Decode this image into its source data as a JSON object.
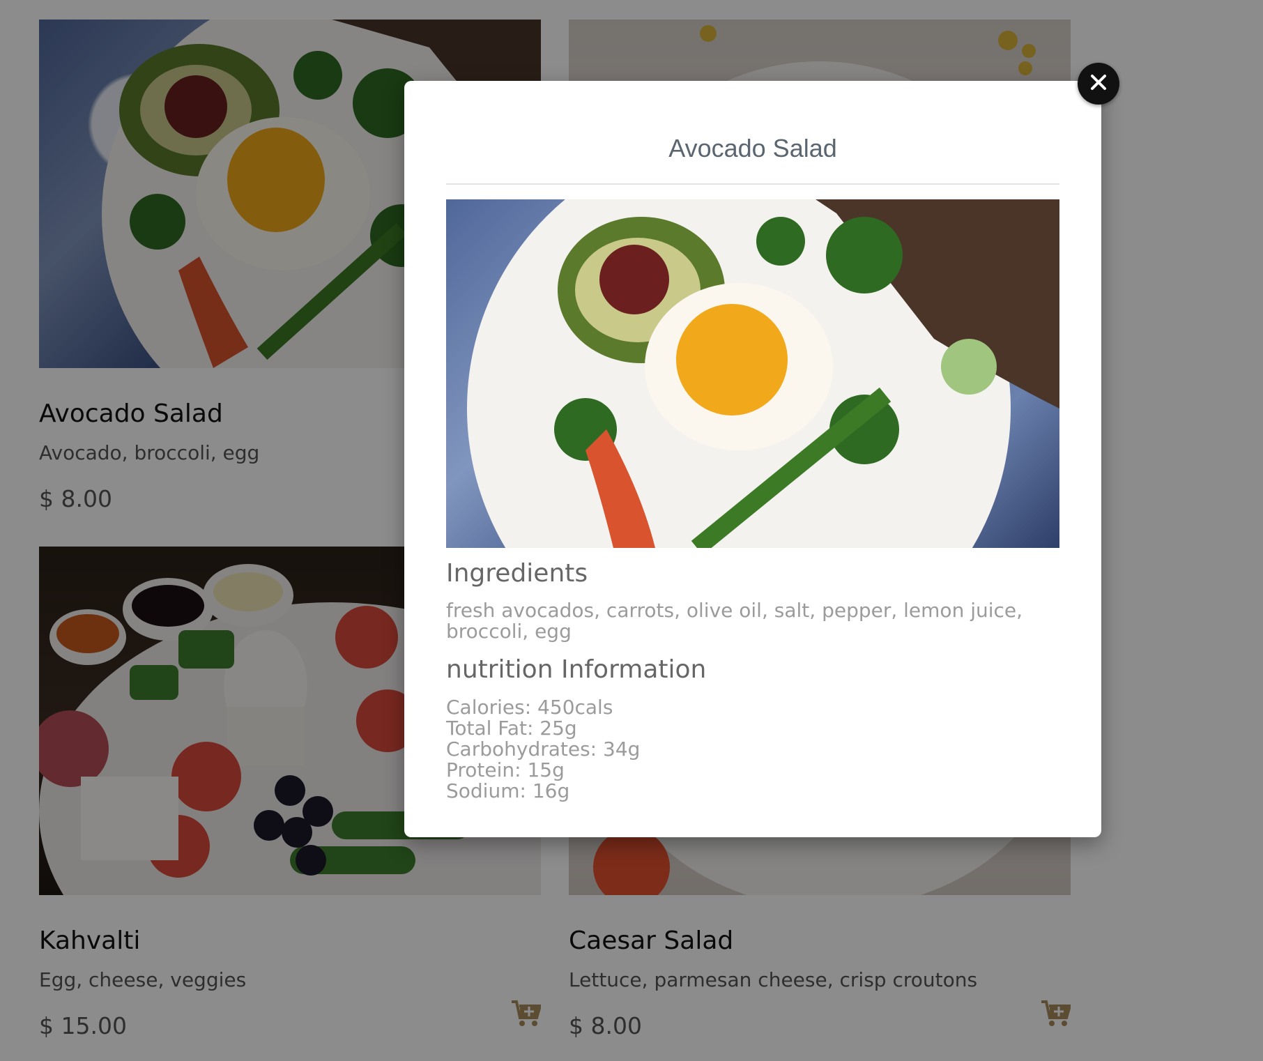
{
  "cards": [
    {
      "name": "Avocado Salad",
      "description": "Avocado, broccoli, egg",
      "price": "$ 8.00",
      "image": "avocado-salad-photo"
    },
    {
      "name": "",
      "description": "",
      "price": "",
      "image": "pasta-photo"
    },
    {
      "name": "Kahvalti",
      "description": "Egg, cheese, veggies",
      "price": "$ 15.00",
      "image": "kahvalti-photo"
    },
    {
      "name": "Caesar Salad",
      "description": "Lettuce, parmesan cheese, crisp croutons",
      "price": "$ 8.00",
      "image": "caesar-salad-photo"
    }
  ],
  "cart_icon": "cart-plus-icon",
  "modal": {
    "title": "Avocado Salad",
    "image": "avocado-salad-photo",
    "ingredients_heading": "Ingredients",
    "ingredients_text": "fresh avocados, carrots, olive oil, salt, pepper, lemon juice, broccoli, egg",
    "nutrition_heading": "nutrition Information",
    "nutrition": [
      "Calories: 450cals",
      "Total Fat: 25g",
      "Carbohydrates: 34g",
      "Protein: 15g",
      "Sodium: 16g"
    ],
    "close_icon": "close-icon"
  },
  "colors": {
    "accent": "#a88a5a",
    "overlay": "rgba(0,0,0,0.45)"
  }
}
